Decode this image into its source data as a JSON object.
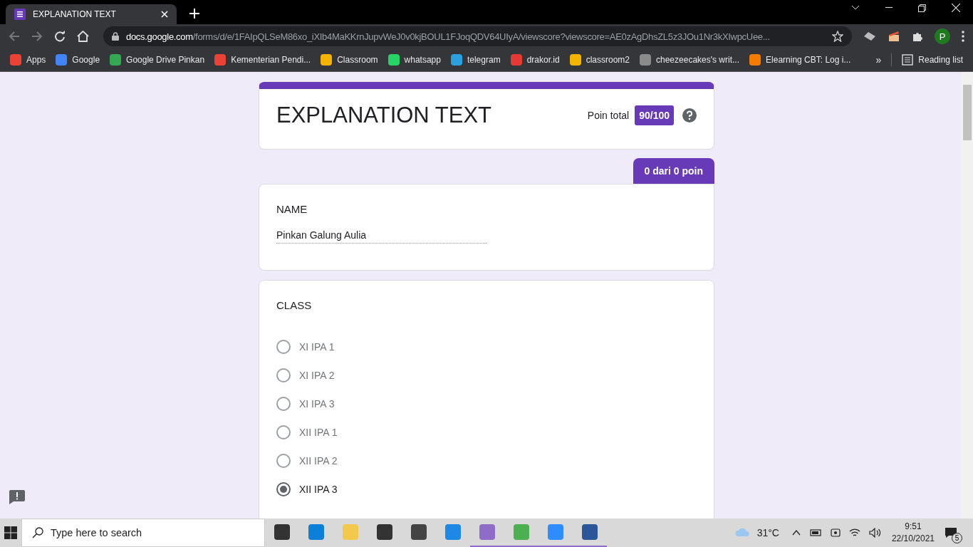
{
  "browser": {
    "tab": {
      "title": "EXPLANATION TEXT"
    },
    "url": {
      "host": "docs.google.com",
      "path": "/forms/d/e/1FAIpQLSeM86xo_iXIb4MaKKrnJupvWeJ0v0kjBOUL1FJoqQDV64UIyA/viewscore?viewscore=AE0zAgDhsZL5z3JOu1Nr3kXIwpcUee..."
    },
    "bookmarks": [
      {
        "label": "Apps",
        "color": "#ea4335"
      },
      {
        "label": "Google",
        "color": "#4285f4"
      },
      {
        "label": "Google Drive Pinkan",
        "color": "#34a853"
      },
      {
        "label": "Kementerian Pendi...",
        "color": "#ea4335"
      },
      {
        "label": "Classroom",
        "color": "#f4b400"
      },
      {
        "label": "whatsapp",
        "color": "#25d366"
      },
      {
        "label": "telegram",
        "color": "#2aa1de"
      },
      {
        "label": "drakor.id",
        "color": "#e53935"
      },
      {
        "label": "classroom2",
        "color": "#f4b400"
      },
      {
        "label": "cheezeecakes's writ...",
        "color": "#8a8a8a"
      },
      {
        "label": "Elearning CBT: Log i...",
        "color": "#f57c00"
      }
    ],
    "overflow": "»",
    "reading_list": "Reading list",
    "profile": "P"
  },
  "form": {
    "title": "EXPLANATION TEXT",
    "points_label": "Poin total",
    "points_value": "90/100",
    "questions": [
      {
        "kind": "text",
        "score": "0 dari 0 poin",
        "title": "NAME",
        "value": "Pinkan Galung Aulia"
      },
      {
        "kind": "choice",
        "title": "CLASS",
        "options": [
          {
            "label": "XI IPA 1",
            "selected": false
          },
          {
            "label": "XI IPA 2",
            "selected": false
          },
          {
            "label": "XI IPA 3",
            "selected": false
          },
          {
            "label": "XII IPA 1",
            "selected": false
          },
          {
            "label": "XII IPA 2",
            "selected": false
          },
          {
            "label": "XII IPA 3",
            "selected": true
          }
        ]
      }
    ]
  },
  "taskbar": {
    "search_placeholder": "Type here to search",
    "temperature": "31°C",
    "time": "9:51",
    "date": "22/10/2021",
    "notifications": "5",
    "apps": [
      {
        "color": "#333333",
        "active": false
      },
      {
        "color": "#0c7fd8",
        "active": false
      },
      {
        "color": "#f2c94c",
        "active": false
      },
      {
        "color": "#333333",
        "active": false
      },
      {
        "color": "#444444",
        "active": false
      },
      {
        "color": "#1e88e5",
        "active": false
      },
      {
        "color": "#8e6cc7",
        "active": true
      },
      {
        "color": "#4caf50",
        "active": true
      },
      {
        "color": "#2d8cff",
        "active": true
      },
      {
        "color": "#2b579a",
        "active": true
      }
    ]
  }
}
